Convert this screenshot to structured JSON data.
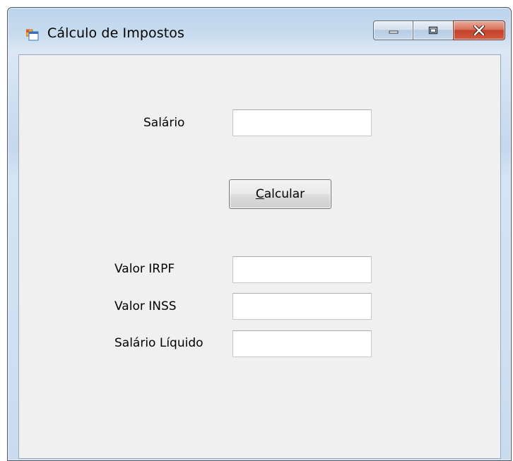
{
  "window": {
    "title": "Cálculo de Impostos",
    "icon": "windows-forms-app-icon"
  },
  "caption_buttons": {
    "minimize_icon": "minimize-icon",
    "maximize_icon": "maximize-icon",
    "close_icon": "close-icon"
  },
  "form": {
    "salario": {
      "label": "Salário",
      "value": ""
    },
    "calcular_button": {
      "mnemonic": "C",
      "rest": "alcular"
    },
    "valor_irpf": {
      "label": "Valor IRPF",
      "value": ""
    },
    "valor_inss": {
      "label": "Valor INSS",
      "value": ""
    },
    "salario_liquido": {
      "label": "Salário Líquido",
      "value": ""
    }
  },
  "colors": {
    "client_background": "#f0f0f0",
    "close_button": "#c2412a",
    "frame_glass": "#c4d8ee"
  }
}
